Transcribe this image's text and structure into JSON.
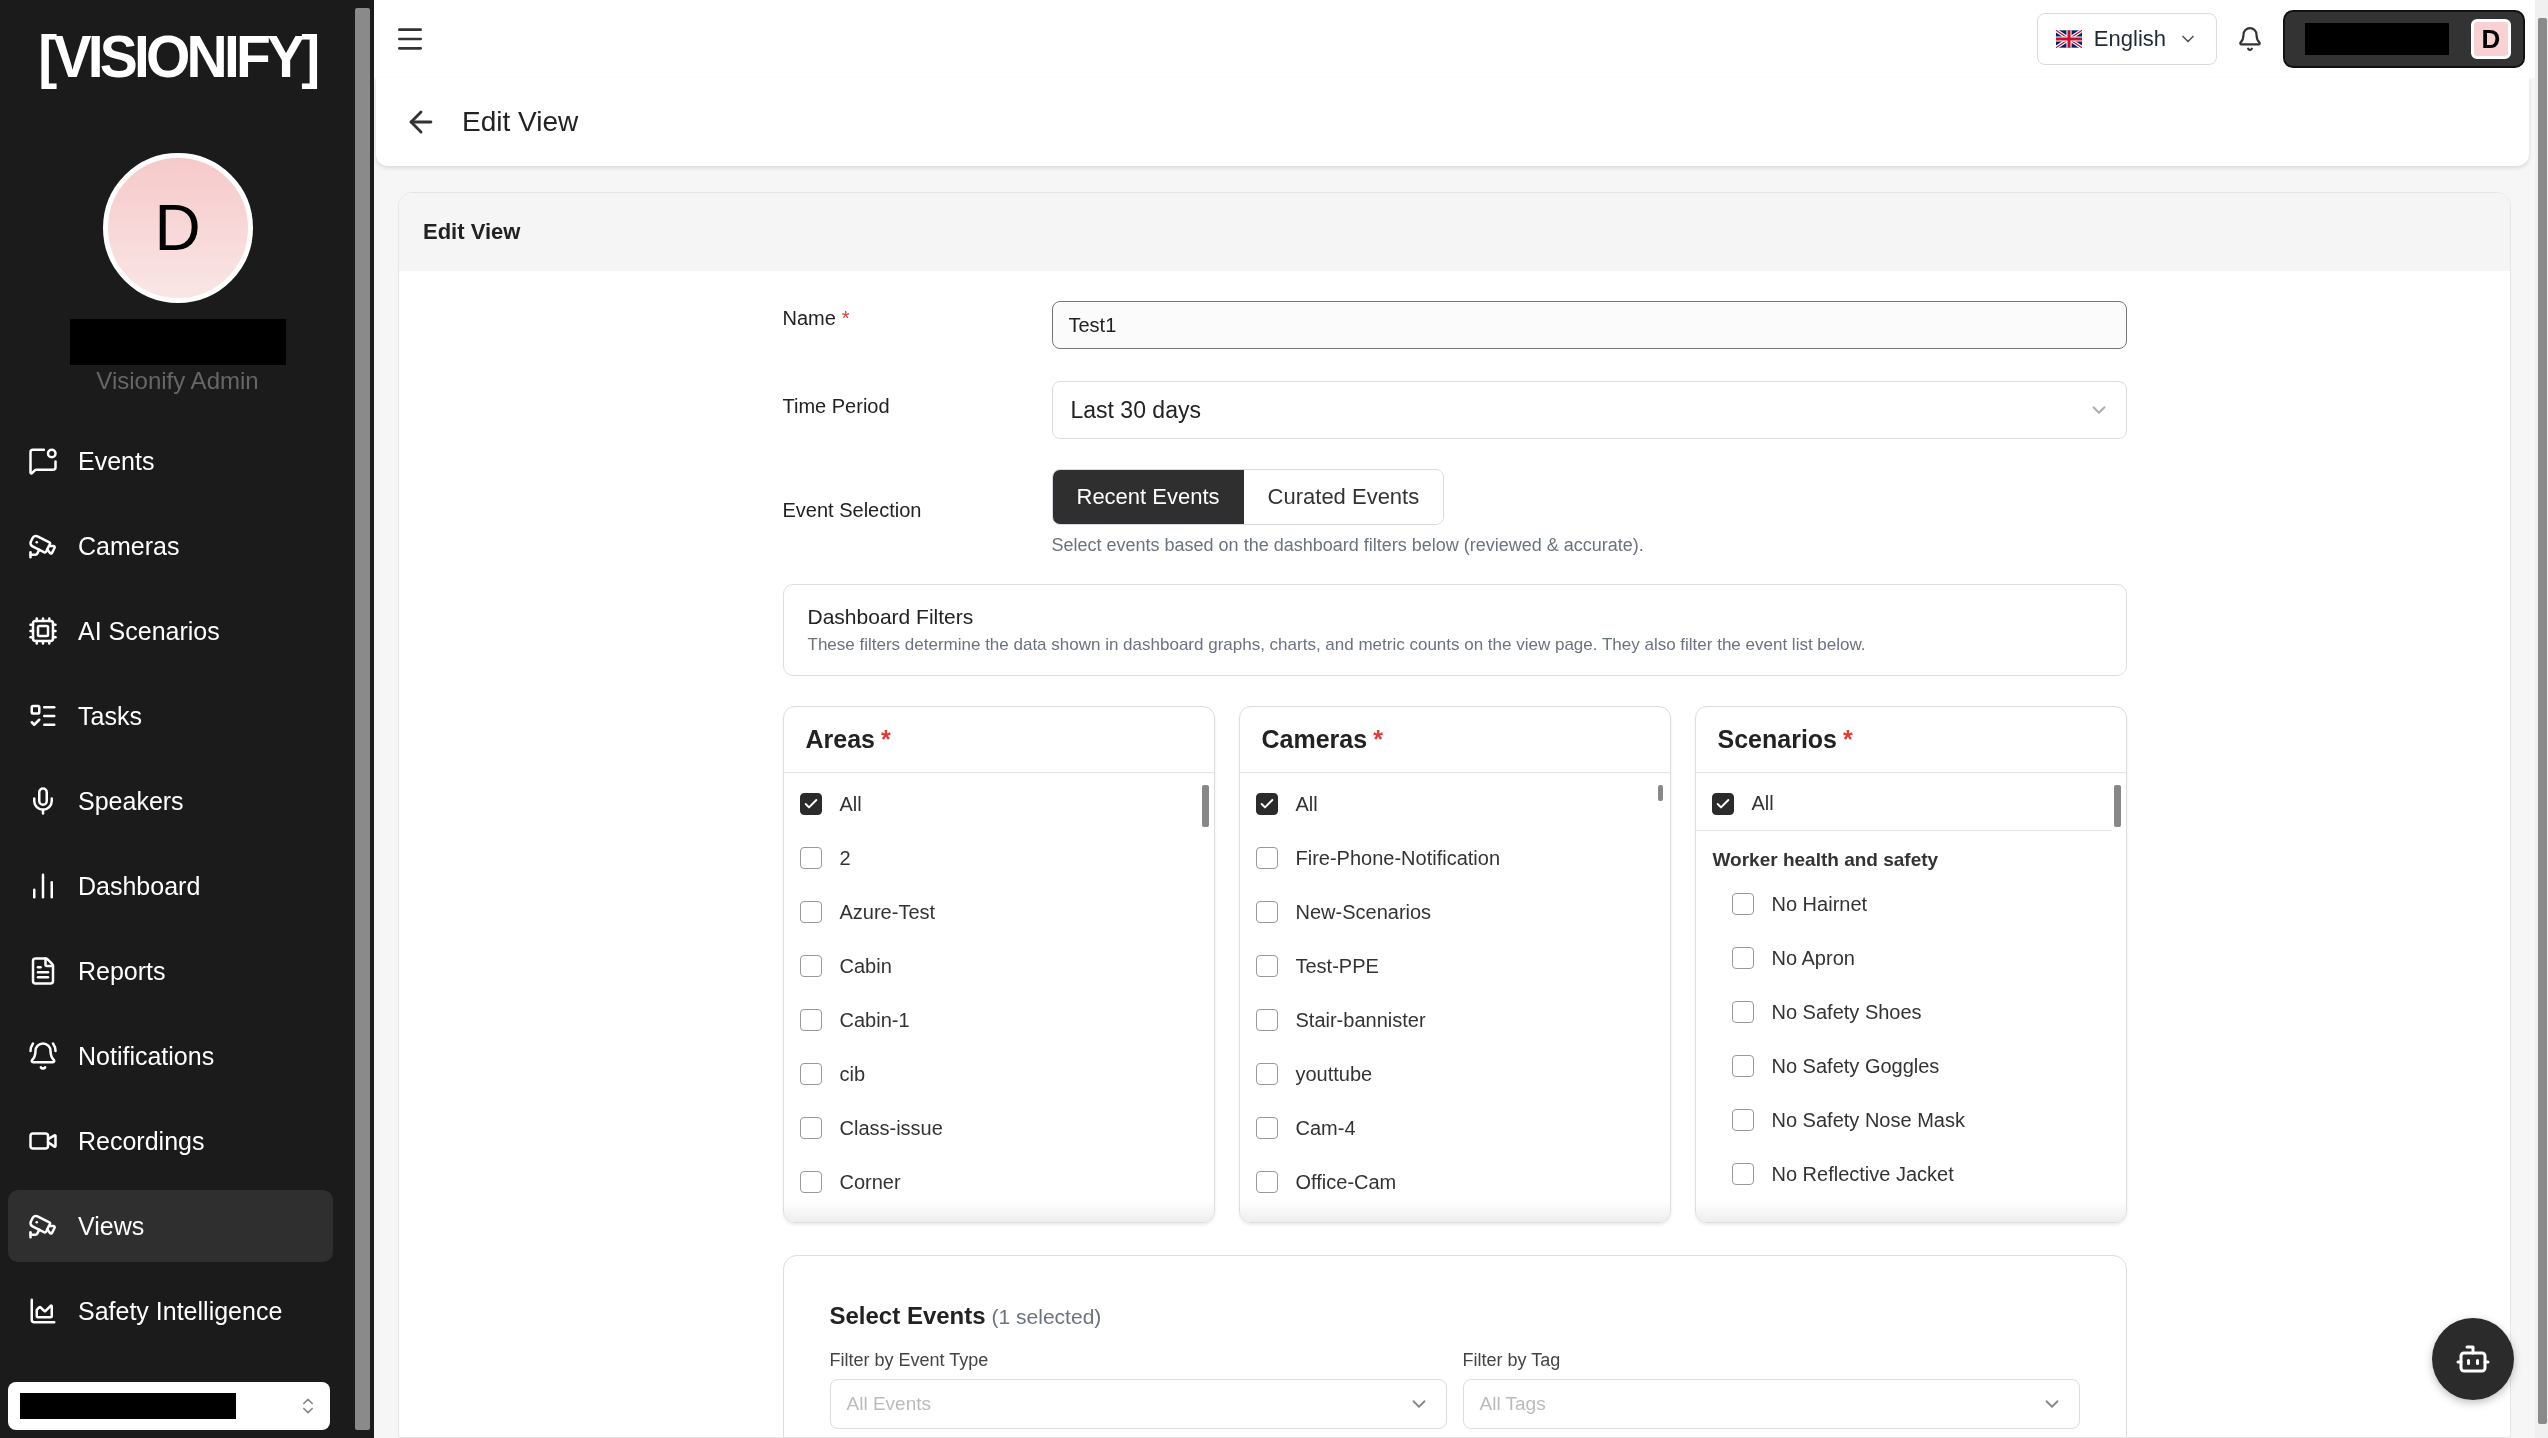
{
  "sidebar": {
    "logo": "[VISIONIFY]",
    "avatar_initial": "D",
    "role": "Visionify Admin",
    "items": [
      {
        "label": "Events",
        "selected": false
      },
      {
        "label": "Cameras",
        "selected": false
      },
      {
        "label": "AI Scenarios",
        "selected": false
      },
      {
        "label": "Tasks",
        "selected": false
      },
      {
        "label": "Speakers",
        "selected": false
      },
      {
        "label": "Dashboard",
        "selected": false
      },
      {
        "label": "Reports",
        "selected": false
      },
      {
        "label": "Notifications",
        "selected": false
      },
      {
        "label": "Recordings",
        "selected": false
      },
      {
        "label": "Views",
        "selected": true
      },
      {
        "label": "Safety Intelligence",
        "selected": false
      }
    ]
  },
  "topbar": {
    "language": "English",
    "user_initial": "D"
  },
  "page_header": {
    "title": "Edit View"
  },
  "card": {
    "title": "Edit View"
  },
  "form": {
    "name": {
      "label": "Name",
      "required_mark": "*",
      "value": "Test1"
    },
    "time_period": {
      "label": "Time Period",
      "value": "Last 30 days"
    },
    "event_selection": {
      "label": "Event Selection",
      "options": [
        {
          "label": "Recent Events",
          "selected": true
        },
        {
          "label": "Curated Events",
          "selected": false
        }
      ],
      "hint": "Select events based on the dashboard filters below (reviewed & accurate)."
    }
  },
  "dashboard_filters": {
    "title": "Dashboard Filters",
    "description": "These filters determine the data shown in dashboard graphs, charts, and metric counts on the view page. They also filter the event list below."
  },
  "filter_columns": [
    {
      "title": "Areas",
      "required_mark": "*",
      "items": [
        {
          "kind": "option",
          "label": "All",
          "checked": true
        },
        {
          "kind": "option",
          "label": "2",
          "checked": false
        },
        {
          "kind": "option",
          "label": "Azure-Test",
          "checked": false
        },
        {
          "kind": "option",
          "label": "Cabin",
          "checked": false
        },
        {
          "kind": "option",
          "label": "Cabin-1",
          "checked": false
        },
        {
          "kind": "option",
          "label": "cib",
          "checked": false
        },
        {
          "kind": "option",
          "label": "Class-issue",
          "checked": false
        },
        {
          "kind": "option",
          "label": "Corner",
          "checked": false
        }
      ]
    },
    {
      "title": "Cameras",
      "required_mark": "*",
      "items": [
        {
          "kind": "option",
          "label": "All",
          "checked": true
        },
        {
          "kind": "option",
          "label": "Fire-Phone-Notification",
          "checked": false
        },
        {
          "kind": "option",
          "label": "New-Scenarios",
          "checked": false
        },
        {
          "kind": "option",
          "label": "Test-PPE",
          "checked": false
        },
        {
          "kind": "option",
          "label": "Stair-bannister",
          "checked": false
        },
        {
          "kind": "option",
          "label": "youttube",
          "checked": false
        },
        {
          "kind": "option",
          "label": "Cam-4",
          "checked": false
        },
        {
          "kind": "option",
          "label": "Office-Cam",
          "checked": false
        }
      ]
    },
    {
      "title": "Scenarios",
      "required_mark": "*",
      "items": [
        {
          "kind": "all",
          "label": "All",
          "checked": true
        },
        {
          "kind": "group",
          "label": "Worker health and safety",
          "children": [
            {
              "kind": "option",
              "label": "No Hairnet",
              "checked": false
            },
            {
              "kind": "option",
              "label": "No Apron",
              "checked": false
            },
            {
              "kind": "option",
              "label": "No Safety Shoes",
              "checked": false
            },
            {
              "kind": "option",
              "label": "No Safety Goggles",
              "checked": false
            },
            {
              "kind": "option",
              "label": "No Safety Nose Mask",
              "checked": false
            },
            {
              "kind": "option",
              "label": "No Reflective Jacket",
              "checked": false
            }
          ]
        }
      ]
    }
  ],
  "select_events": {
    "title": "Select Events",
    "count": "(1 selected)",
    "filters": [
      {
        "label": "Filter by Event Type",
        "placeholder": "All Events"
      },
      {
        "label": "Filter by Tag",
        "placeholder": "All Tags"
      }
    ]
  }
}
